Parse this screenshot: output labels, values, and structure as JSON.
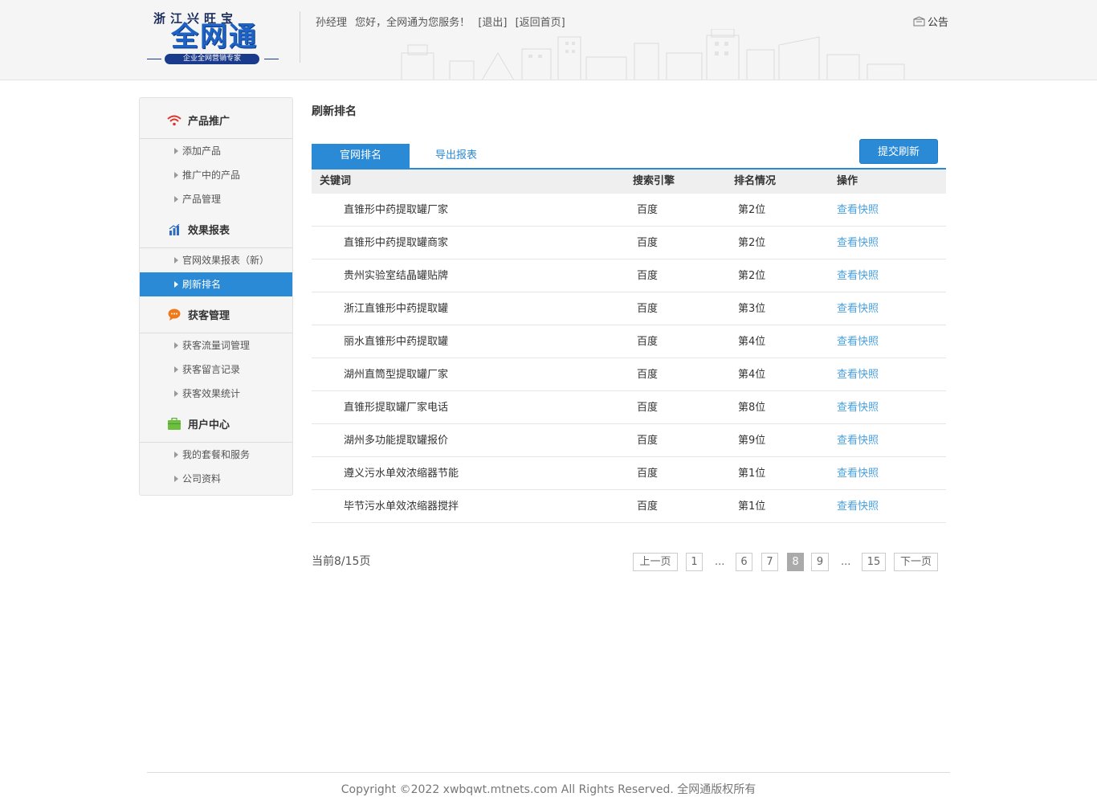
{
  "header": {
    "logo_top": "浙江兴旺宝",
    "logo_main": "全网通",
    "logo_sub": "企业全网营销专家",
    "user_name": "孙经理",
    "greeting": "您好，全网通为您服务！",
    "logout": "[退出]",
    "home": "[返回首页]",
    "notice": "公告"
  },
  "sidebar": {
    "sections": [
      {
        "title": "产品推广",
        "icon": "wifi-icon",
        "items": [
          "添加产品",
          "推广中的产品",
          "产品管理"
        ]
      },
      {
        "title": "效果报表",
        "icon": "chart-icon",
        "items": [
          "官网效果报表（新）",
          "刷新排名"
        ]
      },
      {
        "title": "获客管理",
        "icon": "chat-icon",
        "items": [
          "获客流量词管理",
          "获客留言记录",
          "获客效果统计"
        ]
      },
      {
        "title": "用户中心",
        "icon": "briefcase-icon",
        "items": [
          "我的套餐和服务",
          "公司资料"
        ]
      }
    ],
    "active_item": "刷新排名"
  },
  "main": {
    "title": "刷新排名",
    "tabs": [
      "官网排名",
      "导出报表"
    ],
    "submit": "提交刷新",
    "columns": [
      "关键词",
      "搜索引擎",
      "排名情况",
      "操作"
    ],
    "rows": [
      {
        "keyword": "直锥形中药提取罐厂家",
        "engine": "百度",
        "rank": "第2位",
        "action": "查看快照"
      },
      {
        "keyword": "直锥形中药提取罐商家",
        "engine": "百度",
        "rank": "第2位",
        "action": "查看快照"
      },
      {
        "keyword": "贵州实验室结晶罐贴牌",
        "engine": "百度",
        "rank": "第2位",
        "action": "查看快照"
      },
      {
        "keyword": "浙江直锥形中药提取罐",
        "engine": "百度",
        "rank": "第3位",
        "action": "查看快照"
      },
      {
        "keyword": "丽水直锥形中药提取罐",
        "engine": "百度",
        "rank": "第4位",
        "action": "查看快照"
      },
      {
        "keyword": "湖州直筒型提取罐厂家",
        "engine": "百度",
        "rank": "第4位",
        "action": "查看快照"
      },
      {
        "keyword": "直锥形提取罐厂家电话",
        "engine": "百度",
        "rank": "第8位",
        "action": "查看快照"
      },
      {
        "keyword": "湖州多功能提取罐报价",
        "engine": "百度",
        "rank": "第9位",
        "action": "查看快照"
      },
      {
        "keyword": "遵义污水单效浓缩器节能",
        "engine": "百度",
        "rank": "第1位",
        "action": "查看快照"
      },
      {
        "keyword": "毕节污水单效浓缩器搅拌",
        "engine": "百度",
        "rank": "第1位",
        "action": "查看快照"
      }
    ]
  },
  "pagination": {
    "info": "当前8/15页",
    "prev": "上一页",
    "next": "下一页",
    "pages": [
      "1",
      "...",
      "6",
      "7",
      "8",
      "9",
      "...",
      "15"
    ],
    "current": "8"
  },
  "footer": {
    "text": "Copyright ©2022 xwbqwt.mtnets.com All Rights Reserved. 全网通版权所有"
  }
}
